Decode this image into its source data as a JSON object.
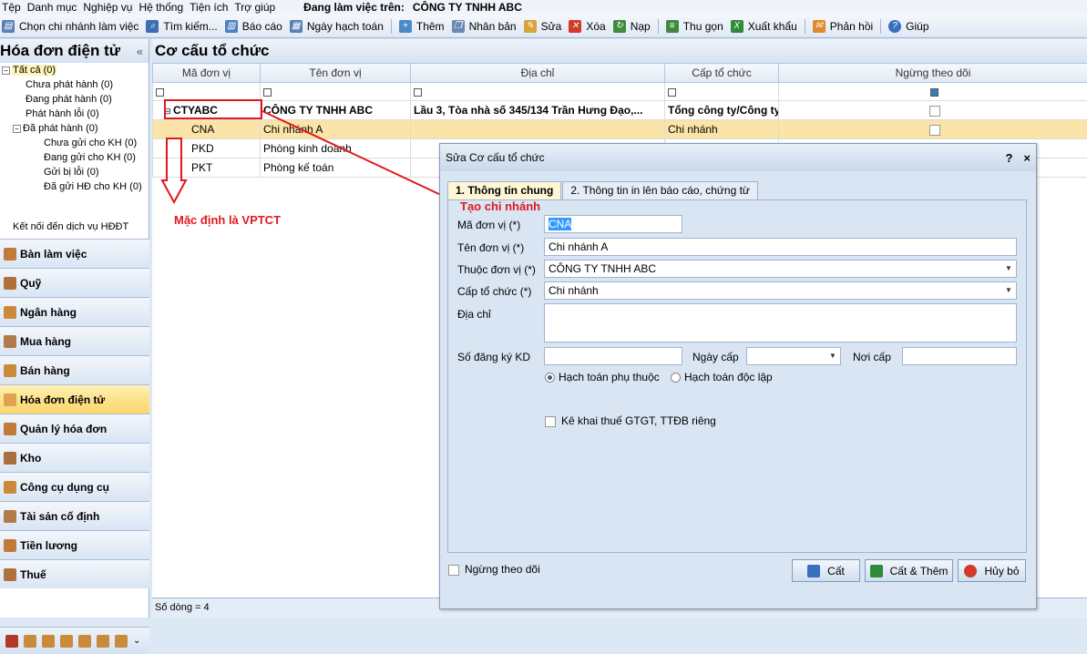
{
  "menu": [
    "Tệp",
    "Danh mục",
    "Nghiệp vụ",
    "Hệ thống",
    "Tiện ích",
    "Trợ giúp"
  ],
  "working": {
    "label": "Đang làm việc trên:",
    "company": "CÔNG TY TNHH ABC"
  },
  "toolbar": [
    {
      "name": "choose-branch",
      "label": "Chọn chi nhánh làm việc",
      "icon": "document-icon",
      "color": "#5a7fb5"
    },
    {
      "name": "search",
      "label": "Tìm kiếm...",
      "icon": "search-icon",
      "color": "#3c6fb0"
    },
    {
      "name": "report",
      "label": "Báo cáo",
      "icon": "report-icon",
      "color": "#4b7fc0"
    },
    {
      "name": "posting-date",
      "label": "Ngày hạch toán",
      "icon": "calendar-icon",
      "color": "#5a7fb5"
    },
    {
      "name": "add",
      "label": "Thêm",
      "icon": "add-icon",
      "color": "#4a8ac8"
    },
    {
      "name": "duplicate",
      "label": "Nhân bản",
      "icon": "copy-icon",
      "color": "#6a8ab0"
    },
    {
      "name": "edit",
      "label": "Sửa",
      "icon": "edit-icon",
      "color": "#d9a23a"
    },
    {
      "name": "delete",
      "label": "Xóa",
      "icon": "delete-icon",
      "color": "#d23a2a"
    },
    {
      "name": "reload",
      "label": "Nạp",
      "icon": "refresh-icon",
      "color": "#3f8a3f"
    },
    {
      "name": "collapse",
      "label": "Thu gọn",
      "icon": "tree-icon",
      "color": "#3f8a3f"
    },
    {
      "name": "export",
      "label": "Xuất khẩu",
      "icon": "excel-icon",
      "color": "#2f8a3a"
    },
    {
      "name": "feedback",
      "label": "Phản hồi",
      "icon": "mail-icon",
      "color": "#e08a2a"
    },
    {
      "name": "help",
      "label": "Giúp",
      "icon": "help-icon",
      "color": "#3a6fc0"
    }
  ],
  "sidebar": {
    "title": "Hóa đơn điện tử",
    "tree": [
      "Tất cả (0)",
      "Chưa phát hành (0)",
      "Đang phát hành (0)",
      "Phát hành lỗi (0)",
      "Đã phát hành (0)",
      "Chưa gửi cho KH (0)",
      "Đang gửi cho KH (0)",
      "Gửi bị lỗi (0)",
      "Đã gửi HĐ cho KH (0)"
    ],
    "connect": "Kết nối đến dịch vụ HĐĐT",
    "modules": [
      "Bàn làm việc",
      "Quỹ",
      "Ngân hàng",
      "Mua hàng",
      "Bán hàng",
      "Hóa đơn điện tử",
      "Quản lý hóa đơn",
      "Kho",
      "Công cụ dụng cụ",
      "Tài sản cố định",
      "Tiền lương",
      "Thuế"
    ]
  },
  "main": {
    "title": "Cơ cấu tổ chức",
    "columns": [
      "Mã đơn vị",
      "Tên đơn vị",
      "Địa chỉ",
      "Cấp tổ chức",
      "Ngừng theo dõi"
    ],
    "rows": [
      {
        "code": "CTYABC",
        "name": "CÔNG TY TNHH ABC",
        "address": "Lầu 3, Tòa nhà số 345/134 Trần Hưng Đạo,...",
        "level": "Tổng công ty/Công ty"
      },
      {
        "code": "CNA",
        "name": "Chi nhánh A",
        "address": "",
        "level": "Chi nhánh"
      },
      {
        "code": "PKD",
        "name": "Phòng kinh doanh",
        "address": "",
        "level": ""
      },
      {
        "code": "PKT",
        "name": "Phòng kế toán",
        "address": "",
        "level": ""
      }
    ],
    "status": "Số dòng = 4"
  },
  "annotations": {
    "default": "Mặc định là VPTCT",
    "create_branch": "Tạo chi nhánh"
  },
  "dialog": {
    "title": "Sửa Cơ cấu tổ chức",
    "help": "?",
    "close": "×",
    "tabs": [
      "1. Thông tin chung",
      "2. Thông tin in lên báo cáo, chứng từ"
    ],
    "labels": {
      "code": "Mã đơn vị (*)",
      "name": "Tên đơn vị (*)",
      "parent": "Thuộc đơn vị (*)",
      "level": "Cấp tổ chức (*)",
      "address": "Địa chỉ",
      "reg_no": "Số đăng ký KD",
      "issue_date": "Ngày cấp",
      "issue_place": "Nơi cấp",
      "dependent": "Hạch toán phụ thuộc",
      "independent": "Hạch toán độc lập",
      "tax_decl": "Kê khai thuế GTGT, TTĐB riêng",
      "stop_tracking": "Ngừng theo dõi"
    },
    "values": {
      "code": "CNA",
      "name": "Chi nhánh A",
      "parent": "CÔNG TY TNHH ABC",
      "level": "Chi nhánh",
      "address": "",
      "reg_no": "",
      "issue_date": "",
      "issue_place": "",
      "accounting": "dependent"
    },
    "buttons": {
      "save": "Cất",
      "save_add": "Cất & Thêm",
      "cancel": "Hủy bỏ"
    }
  }
}
